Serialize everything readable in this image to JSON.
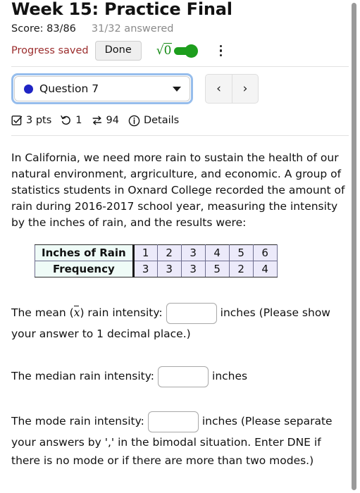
{
  "header": {
    "quiz_title": "Week 15: Practice Final",
    "score_label": "Score: 83/86",
    "answered_label": "31/32 answered",
    "progress_status": "Progress saved",
    "done_label": "Done",
    "math_toggle_glyph": "√0",
    "math_toggle_state": "on",
    "accent_green": "#1d9e1d",
    "progress_color": "#9b2c2c",
    "more_menu_label": "⋮"
  },
  "selector": {
    "question_label": "Question 7",
    "dot_color": "#1f24c4",
    "caret_glyph": "▼",
    "focus_ring_color": "#96bdec",
    "prev_glyph": "‹",
    "next_glyph": "›"
  },
  "meta": {
    "points": "3 pts",
    "attempts": "1",
    "retries": "94",
    "details_label": "Details"
  },
  "question": {
    "prompt": "In California, we need more rain to sustain the health of our natural environment, argriculture, and economic. A group of statistics students in Oxnard College recorded the amount of rain during 2016-2017 school year, measuring the intensity by the inches of rain, and the results were:"
  },
  "chart_data": {
    "type": "table",
    "title": "",
    "row_labels": [
      "Inches of Rain",
      "Frequency"
    ],
    "categories": [
      "1",
      "2",
      "3",
      "4",
      "5",
      "6"
    ],
    "values": [
      3,
      3,
      3,
      5,
      2,
      4
    ],
    "label_cell_bg": "#effbf7",
    "value_cell_bg": "#eceafa"
  },
  "answers": {
    "mean": {
      "prefix": "The mean (",
      "symbol": "x",
      "suffix": ") rain intensity:",
      "unit": "inches (Please show",
      "tail": "your answer to 1 decimal place.)",
      "value": "",
      "placeholder": ""
    },
    "median": {
      "prefix": "The median rain intensity:",
      "unit": "inches",
      "tail": "",
      "value": "",
      "placeholder": ""
    },
    "mode": {
      "prefix": "The mode rain intensity:",
      "unit": "inches (Please separate",
      "tail": "your answers by ',' in the bimodal situation. Enter DNE if there is no mode or if there are more than two modes.)",
      "value": "",
      "placeholder": ""
    }
  }
}
